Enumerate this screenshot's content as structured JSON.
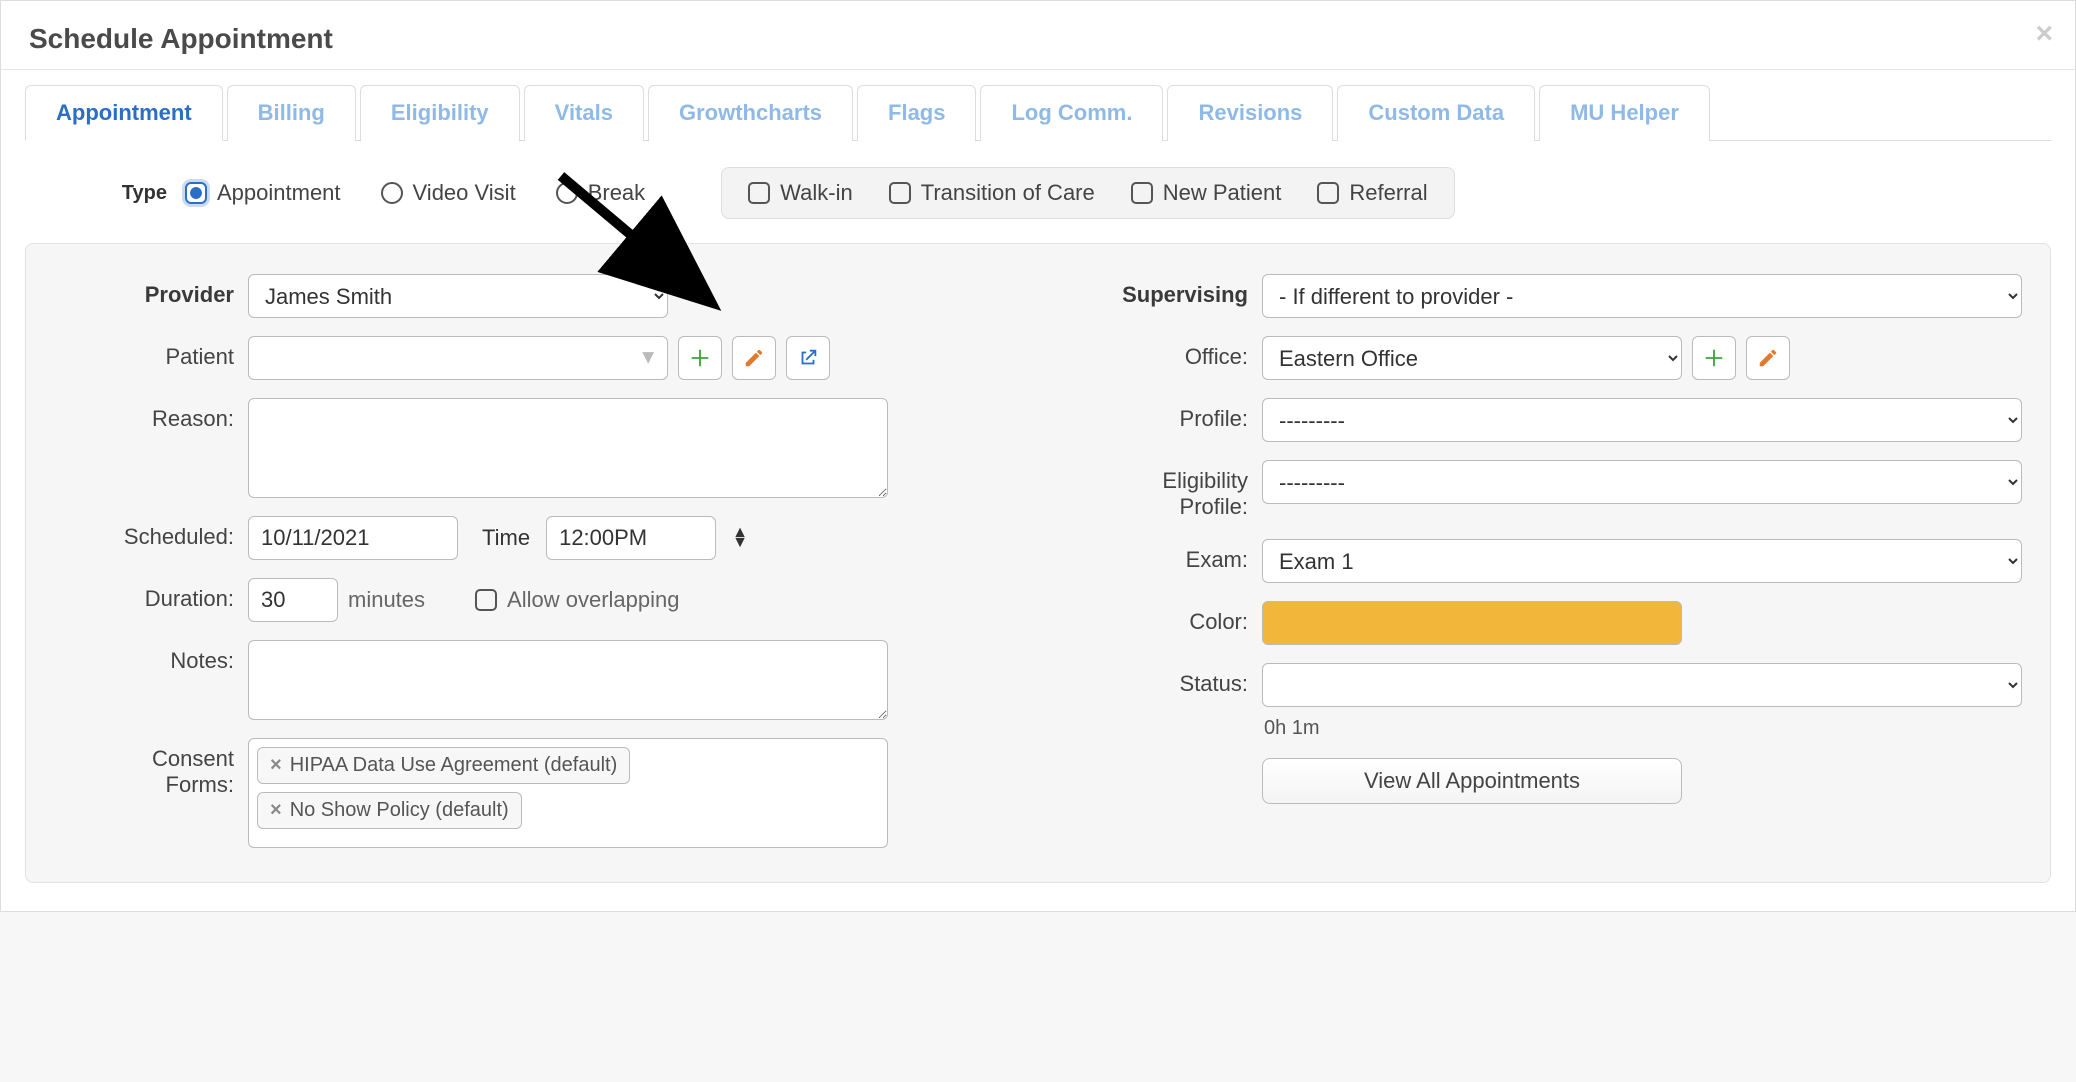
{
  "modal": {
    "title": "Schedule Appointment"
  },
  "tabs": [
    "Appointment",
    "Billing",
    "Eligibility",
    "Vitals",
    "Growthcharts",
    "Flags",
    "Log Comm.",
    "Revisions",
    "Custom Data",
    "MU Helper"
  ],
  "active_tab_index": 0,
  "type": {
    "label": "Type",
    "options": [
      "Appointment",
      "Video Visit",
      "Break"
    ],
    "selected": "Appointment",
    "checks": [
      "Walk-in",
      "Transition of Care",
      "New Patient",
      "Referral"
    ]
  },
  "left": {
    "provider_label": "Provider",
    "provider_value": "James Smith",
    "patient_label": "Patient",
    "patient_value": "",
    "reason_label": "Reason:",
    "reason_value": "",
    "scheduled_label": "Scheduled:",
    "scheduled_date": "10/11/2021",
    "time_label": "Time",
    "scheduled_time": "12:00PM",
    "duration_label": "Duration:",
    "duration_value": "30",
    "duration_unit": "minutes",
    "allow_overlap_label": "Allow overlapping",
    "notes_label": "Notes:",
    "notes_value": "",
    "consent_label": "Consent Forms:",
    "consent_tags": [
      "HIPAA Data Use Agreement (default)",
      "No Show Policy (default)"
    ]
  },
  "right": {
    "supervising_label": "Supervising",
    "supervising_value": "- If different to provider -",
    "office_label": "Office:",
    "office_value": "Eastern Office",
    "profile_label": "Profile:",
    "profile_value": "---------",
    "elig_profile_label": "Eligibility Profile:",
    "elig_profile_value": "---------",
    "exam_label": "Exam:",
    "exam_value": "Exam 1",
    "color_label": "Color:",
    "color_hex": "#f1b63a",
    "status_label": "Status:",
    "status_value": "",
    "status_note": "0h 1m",
    "view_all_btn": "View All Appointments"
  }
}
